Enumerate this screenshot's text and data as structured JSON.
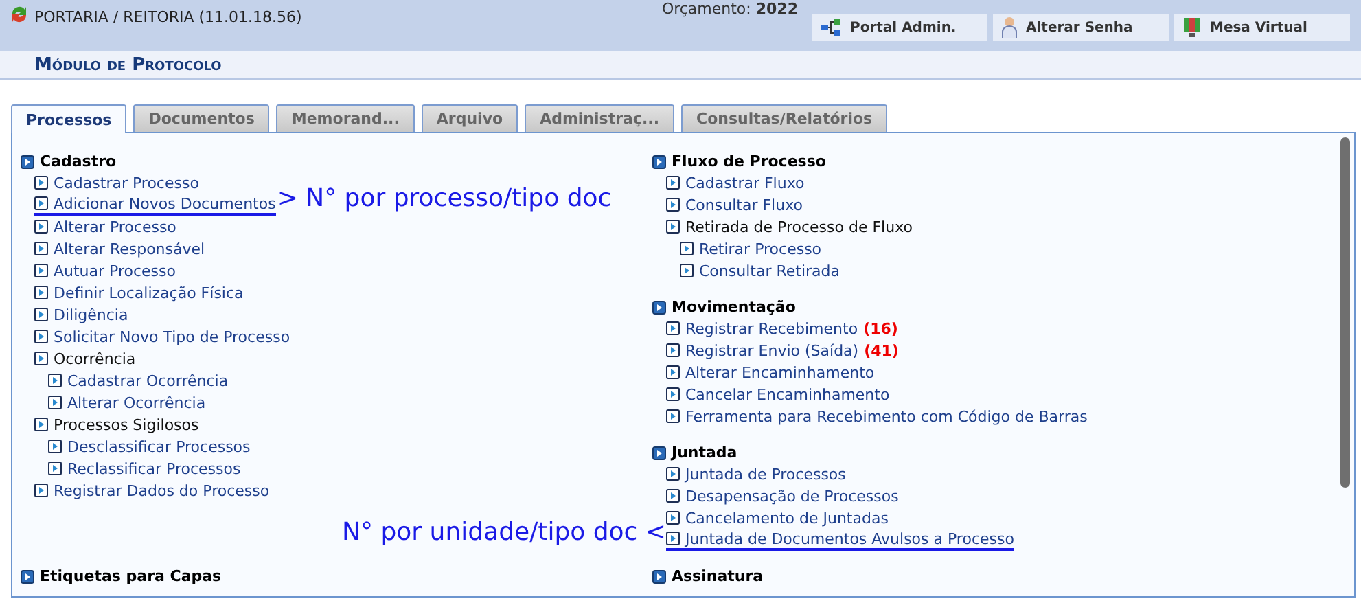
{
  "header": {
    "unit": "PORTARIA / REITORIA (11.01.18.56)",
    "budget_label": "Orçamento:",
    "budget_year": "2022",
    "buttons": [
      {
        "label": "Portal Admin.",
        "kind": "network"
      },
      {
        "label": "Alterar Senha",
        "kind": "person"
      },
      {
        "label": "Mesa Virtual",
        "kind": "monitor"
      }
    ]
  },
  "module_title": "Módulo de Protocolo",
  "tabs": [
    {
      "label": "Processos",
      "selected": true
    },
    {
      "label": "Documentos",
      "selected": false
    },
    {
      "label": "Memorand...",
      "selected": false
    },
    {
      "label": "Arquivo",
      "selected": false
    },
    {
      "label": "Administraç...",
      "selected": false
    },
    {
      "label": "Consultas/Relatórios",
      "selected": false
    }
  ],
  "rows": [
    {
      "left": [
        {
          "title": "Cadastro",
          "items": [
            {
              "label": "Cadastrar Processo",
              "kind": "link"
            },
            {
              "label": "Adicionar Novos Documentos",
              "kind": "link",
              "underlined": true,
              "note_after": "> N° por processo/tipo doc"
            },
            {
              "label": "Alterar Processo",
              "kind": "link"
            },
            {
              "label": "Alterar Responsável",
              "kind": "link"
            },
            {
              "label": "Autuar Processo",
              "kind": "link"
            },
            {
              "label": "Definir Localização Física",
              "kind": "link"
            },
            {
              "label": "Diligência",
              "kind": "link"
            },
            {
              "label": "Solicitar Novo Tipo de Processo",
              "kind": "link"
            },
            {
              "label": "Ocorrência",
              "kind": "group",
              "children": [
                {
                  "label": "Cadastrar Ocorrência",
                  "kind": "link"
                },
                {
                  "label": "Alterar Ocorrência",
                  "kind": "link"
                }
              ]
            },
            {
              "label": "Processos Sigilosos",
              "kind": "group",
              "children": [
                {
                  "label": "Desclassificar Processos",
                  "kind": "link"
                },
                {
                  "label": "Reclassificar Processos",
                  "kind": "link"
                }
              ]
            },
            {
              "label": "Registrar Dados do Processo",
              "kind": "link"
            }
          ]
        }
      ],
      "right": [
        {
          "title": "Fluxo de Processo",
          "items": [
            {
              "label": "Cadastrar Fluxo",
              "kind": "link"
            },
            {
              "label": "Consultar Fluxo",
              "kind": "link"
            },
            {
              "label": "Retirada de Processo de Fluxo",
              "kind": "group",
              "children": [
                {
                  "label": "Retirar Processo",
                  "kind": "link"
                },
                {
                  "label": "Consultar Retirada",
                  "kind": "link"
                }
              ]
            }
          ]
        },
        {
          "title": "Movimentação",
          "items": [
            {
              "label": "Registrar Recebimento",
              "kind": "link",
              "count": "(16)"
            },
            {
              "label": "Registrar Envio (Saída)",
              "kind": "link",
              "count": "(41)"
            },
            {
              "label": "Alterar Encaminhamento",
              "kind": "link"
            },
            {
              "label": "Cancelar Encaminhamento",
              "kind": "link"
            },
            {
              "label": "Ferramenta para Recebimento com Código de Barras",
              "kind": "link"
            }
          ]
        },
        {
          "title": "Juntada",
          "items": [
            {
              "label": "Juntada de Processos",
              "kind": "link"
            },
            {
              "label": "Desapensação de Processos",
              "kind": "link"
            },
            {
              "label": "Cancelamento de Juntadas",
              "kind": "link"
            },
            {
              "label": "Juntada de Documentos Avulsos a Processo",
              "kind": "link",
              "underlined": true,
              "note_before": "N° por unidade/tipo doc <"
            }
          ]
        }
      ]
    },
    {
      "left": [
        {
          "title": "Etiquetas para Capas"
        }
      ],
      "right": [
        {
          "title": "Assinatura"
        }
      ]
    }
  ]
}
